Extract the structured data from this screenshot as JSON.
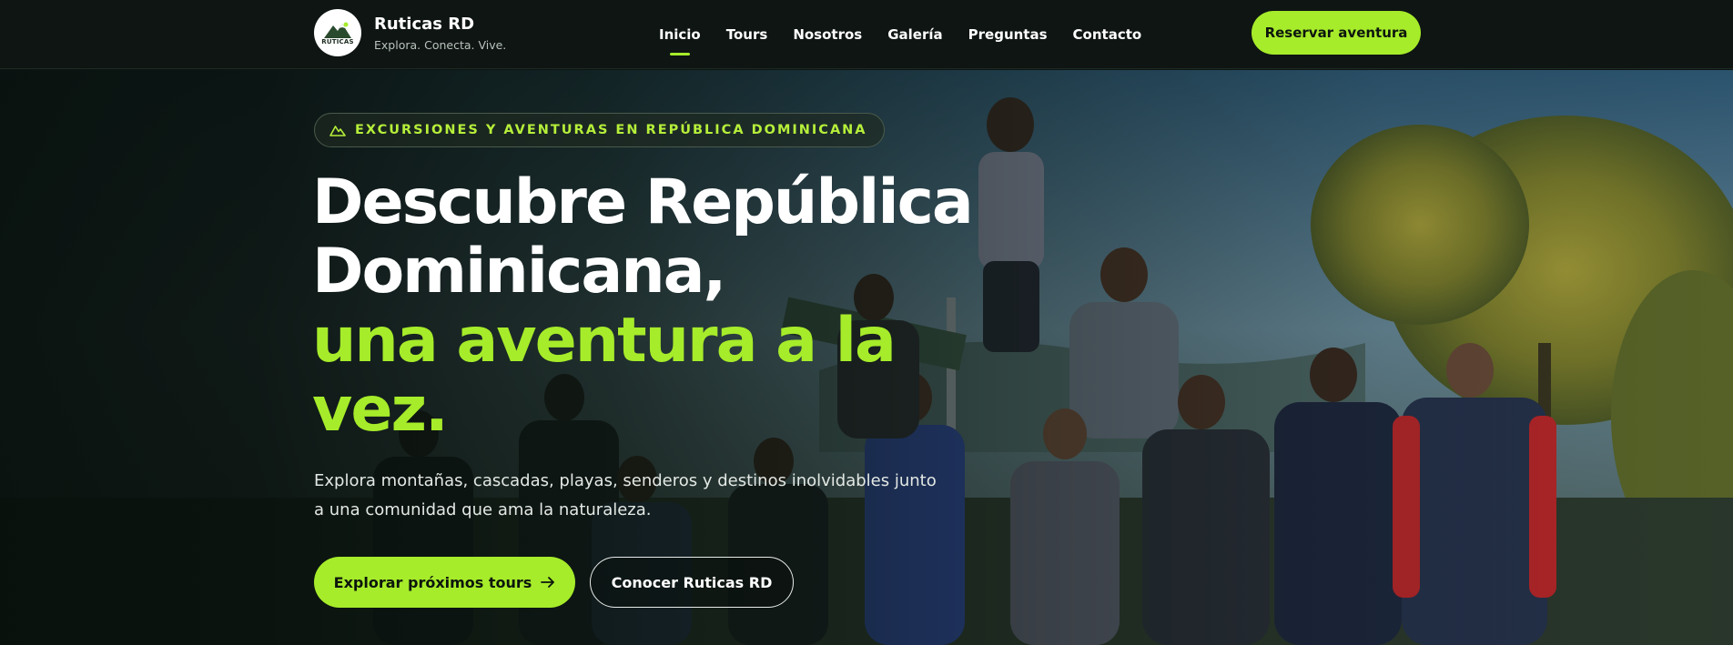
{
  "brand": {
    "name": "Ruticas RD",
    "tagline": "Explora. Conecta. Vive.",
    "logo_text": "RUTICAS"
  },
  "nav": {
    "items": [
      {
        "label": "Inicio",
        "active": true
      },
      {
        "label": "Tours",
        "active": false
      },
      {
        "label": "Nosotros",
        "active": false
      },
      {
        "label": "Galería",
        "active": false
      },
      {
        "label": "Preguntas",
        "active": false
      },
      {
        "label": "Contacto",
        "active": false
      }
    ],
    "cta_label": "Reservar aventura"
  },
  "hero": {
    "eyebrow": "EXCURSIONES Y AVENTURAS EN REPÚBLICA DOMINICANA",
    "headline_line1": "Descubre República",
    "headline_line2": "Dominicana,",
    "headline_accent_line1": "una aventura a la",
    "headline_accent_line2": "vez.",
    "lead": "Explora montañas, cascadas, playas, senderos y destinos inolvidables junto a una comunidad que ama la naturaleza.",
    "primary_button": "Explorar próximos tours",
    "secondary_button": "Conocer Ruticas RD"
  },
  "colors": {
    "accent": "#a6ec2a",
    "header_bg": "#0e1512",
    "text_primary": "#ffffff"
  },
  "icons": {
    "eyebrow_icon": "mountain-icon",
    "primary_button_icon": "arrow-right-icon"
  }
}
